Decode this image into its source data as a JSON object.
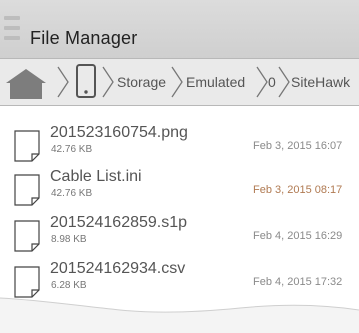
{
  "app": {
    "title": "File Manager"
  },
  "toolbar": {
    "menu_icon": "hamburger-menu-icon"
  },
  "breadcrumb": {
    "home_icon": "home-icon",
    "device_icon": "phone-icon",
    "items": [
      "Storage",
      "Emulated",
      "0",
      "SiteHawk"
    ]
  },
  "files": [
    {
      "name": "201523160754.png",
      "size": "42.76 KB",
      "date": "Feb 3, 2015 16:07",
      "icon": "file-icon"
    },
    {
      "name": "Cable List.ini",
      "size": "42.76 KB",
      "date": "Feb 3, 2015 08:17",
      "icon": "file-icon"
    },
    {
      "name": "201524162859.s1p",
      "size": "8.98 KB",
      "date": "Feb 4, 2015 16:29",
      "icon": "file-icon"
    },
    {
      "name": "201524162934.csv",
      "size": "6.28 KB",
      "date": "Feb 4, 2015 17:32",
      "icon": "file-icon"
    }
  ],
  "colors": {
    "titlebar": "#d4d4d4",
    "breadcrumb_bg": "#eaeaea",
    "breadcrumb_icons": "#7a7a7a",
    "text_primary": "#555555",
    "date_highlight": "#b07a52"
  }
}
